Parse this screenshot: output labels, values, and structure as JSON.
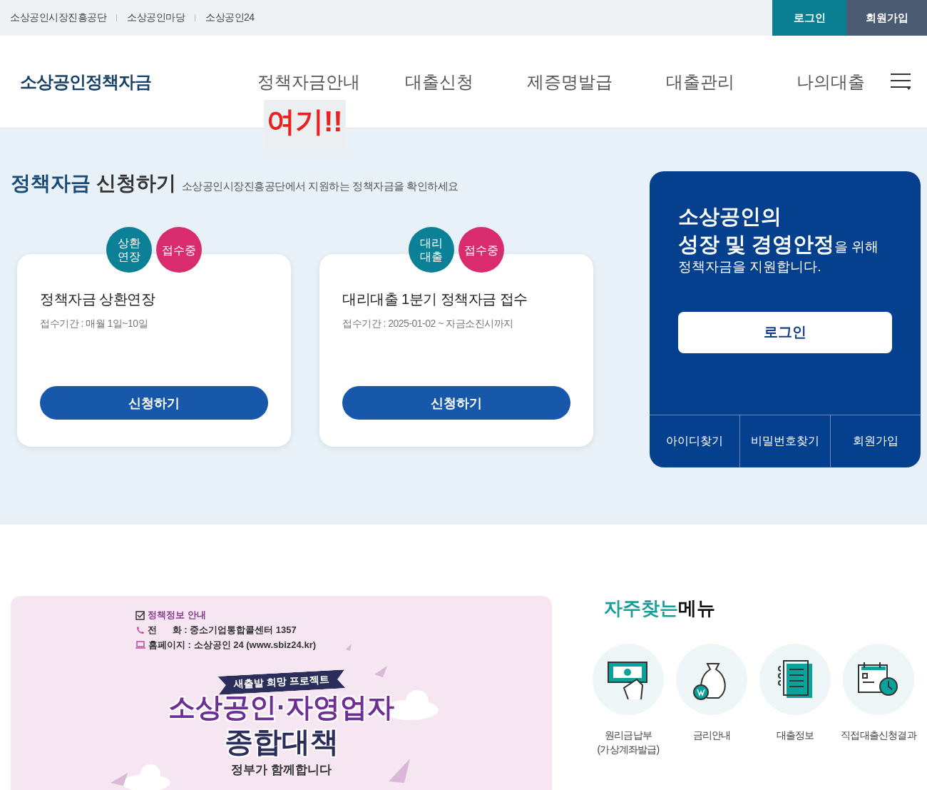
{
  "top_links": [
    "소상공인시장진흥공단",
    "소상공인마당",
    "소상공인24"
  ],
  "top_buttons": [
    {
      "label": "로그인",
      "kind": "login"
    },
    {
      "label": "회원가입",
      "kind": "join"
    }
  ],
  "logo": "소상공인정책자금",
  "nav": [
    "정책자금안내",
    "대출신청",
    "제증명발급",
    "대출관리",
    "나의대출"
  ],
  "annotation": {
    "text": "여기!!"
  },
  "section": {
    "title_accent": "정책자금",
    "title_rest": "신청하기",
    "subtitle": "소상공인시장진흥공단에서 지원하는 정책자금을 확인하세요"
  },
  "cards": [
    {
      "badges": [
        {
          "text": "상환\n연장",
          "color": "#0b8096"
        },
        {
          "text": "접수중",
          "color": "#d92c6f"
        }
      ],
      "title": "정책자금 상환연장",
      "period": "접수기간 : 매월 1일~10일",
      "button": "신청하기"
    },
    {
      "badges": [
        {
          "text": "대리\n대출",
          "color": "#0b8096"
        },
        {
          "text": "접수중",
          "color": "#d92c6f"
        }
      ],
      "title": "대리대출 1분기 정책자금 접수",
      "period": "접수기간 : 2025-01-02 ~ 자금소진시까지",
      "button": "신청하기"
    }
  ],
  "panel": {
    "message": [
      [
        {
          "text": "소상공인의",
          "kind": "headline"
        }
      ],
      [
        {
          "text": "성장 및 경영안정",
          "kind": "headline"
        },
        {
          "text": "을 위해",
          "kind": "body"
        }
      ],
      [
        {
          "text": "정책자금을 지원합니다.",
          "kind": "body"
        }
      ]
    ],
    "login": "로그인",
    "links": [
      "아이디찾기",
      "비밀번호찾기",
      "회원가입"
    ]
  },
  "banner": {
    "info_title": "정책정보 안내",
    "info_lines": [
      {
        "label": "전      화 :",
        "value": "중소기업통합콜센터 1357",
        "kind": "phone"
      },
      {
        "label": "홈페이지 :",
        "value": "소상공인 24 (www.sbiz24.kr)",
        "kind": "web"
      }
    ],
    "ribbon": "새출발 희망 프로젝트",
    "headline": [
      "소상공인·자영업자",
      "종합대책"
    ],
    "footer": "정부가 함께합니다"
  },
  "quick_menu": {
    "title_accent": "자주찾는",
    "title_rest": "메뉴",
    "items": [
      {
        "label": "원리금납부(가상계좌발급)",
        "kind": "cash"
      },
      {
        "label": "금리안내",
        "kind": "bag"
      },
      {
        "label": "대출정보",
        "kind": "document"
      },
      {
        "label": "직접대출신청결과",
        "kind": "calendar"
      }
    ]
  }
}
